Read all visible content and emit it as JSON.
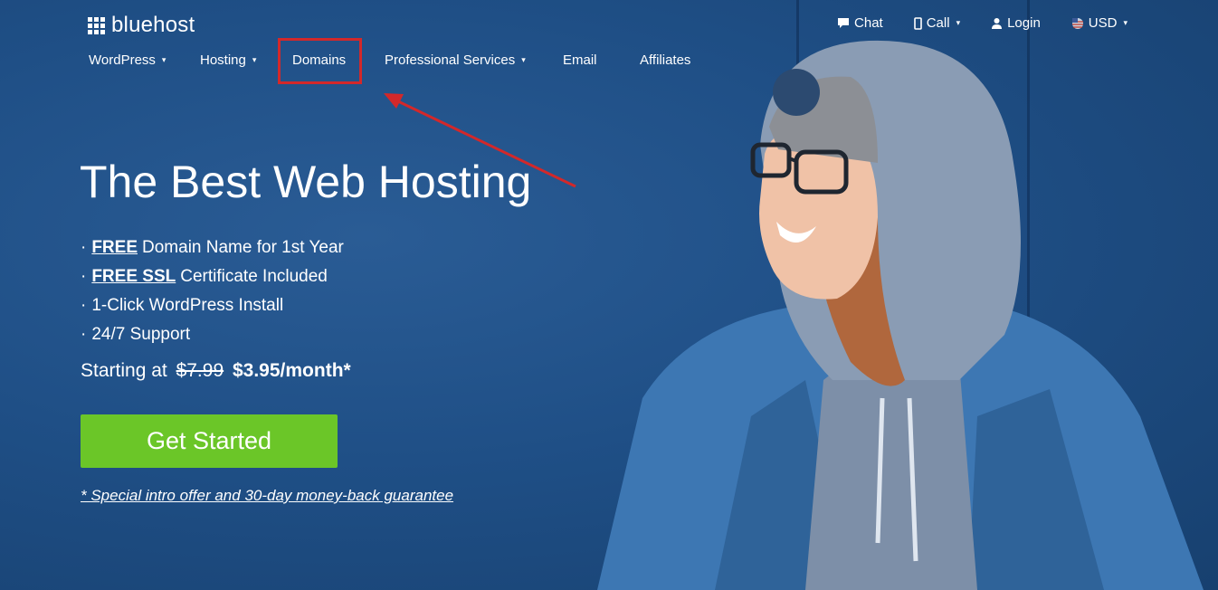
{
  "brand": {
    "name": "bluehost"
  },
  "utility_nav": [
    {
      "label": "Chat",
      "icon": "chat-icon"
    },
    {
      "label": "Call",
      "icon": "phone-icon"
    },
    {
      "label": "Login",
      "icon": "user-icon"
    },
    {
      "label": "USD",
      "icon": "us-flag-icon"
    }
  ],
  "main_nav": [
    {
      "label": "WordPress",
      "dropdown": true
    },
    {
      "label": "Hosting",
      "dropdown": true
    },
    {
      "label": "Domains",
      "dropdown": false
    },
    {
      "label": "Professional Services",
      "dropdown": true
    },
    {
      "label": "Email",
      "dropdown": false
    },
    {
      "label": "Affiliates",
      "dropdown": false
    }
  ],
  "hero": {
    "title": "The Best Web Hosting",
    "features": [
      {
        "bullet": "·",
        "strong": "FREE",
        "text": "Domain Name for 1st Year"
      },
      {
        "bullet": "·",
        "strong": "FREE SSL",
        "text": "Certificate Included"
      },
      {
        "bullet": "·",
        "strong": "",
        "text": "1-Click WordPress Install"
      },
      {
        "bullet": "·",
        "strong": "",
        "text": "24/7 Support"
      }
    ],
    "price_prefix": "Starting at",
    "old_price": "$7.99",
    "new_price": "$3.95/month*",
    "cta_label": "Get Started",
    "guarantee": "* Special intro offer and 30-day money-back guarantee"
  },
  "colors": {
    "background": "#1e4f86",
    "cta": "#6bc628",
    "annotation": "#d3282a"
  }
}
